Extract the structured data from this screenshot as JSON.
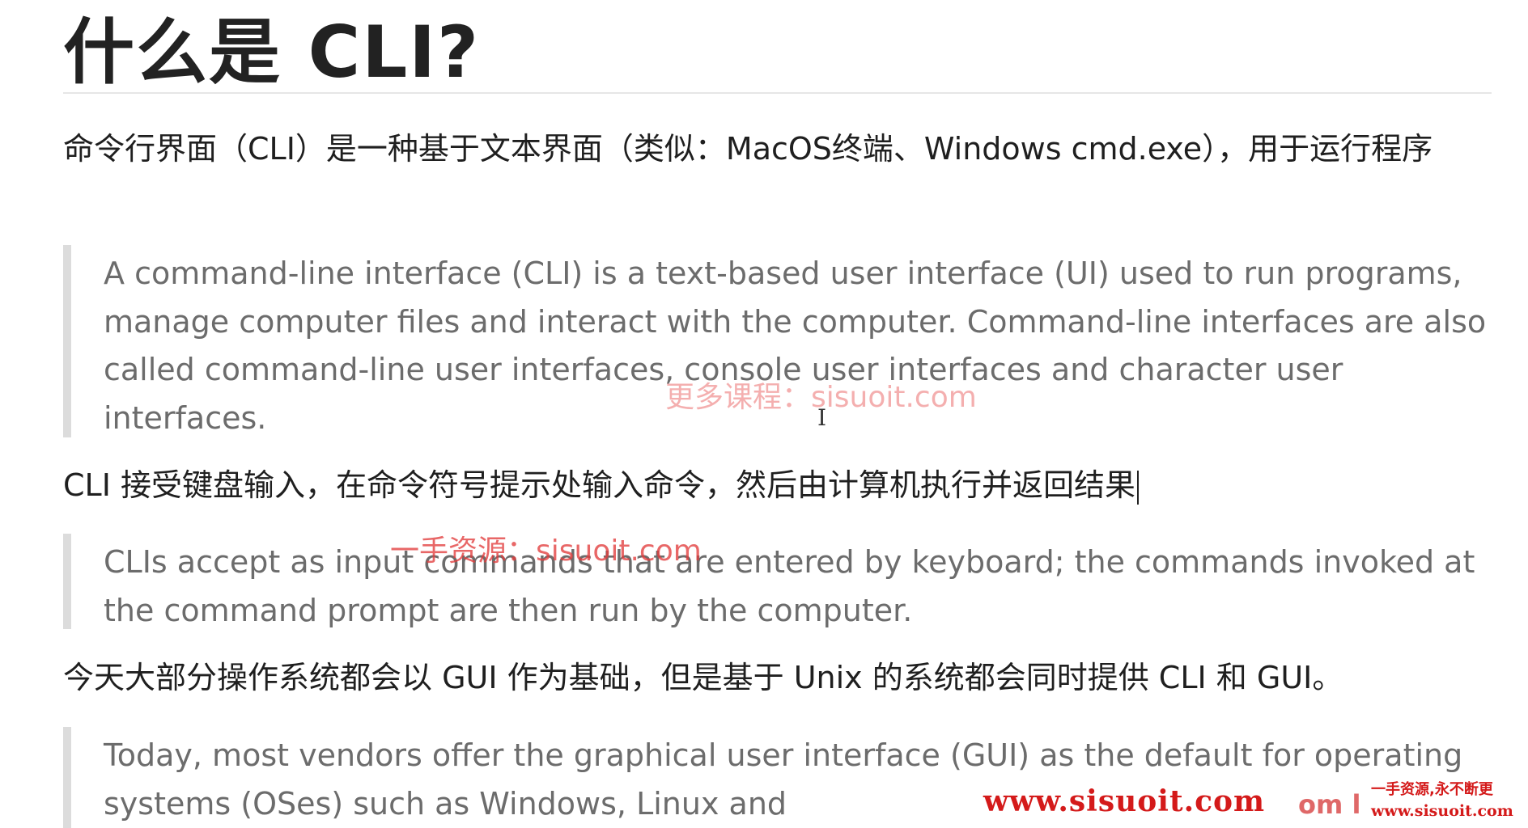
{
  "title": "什么是 CLI?",
  "paragraphs": {
    "p1": "命令行界面（CLI）是一种基于文本界面（类似：MacOS终端、Windows cmd.exe），用于运行程序",
    "p2": "CLI 接受键盘输入，在命令符号提示处输入命令，然后由计算机执行并返回结果",
    "p3": "今天大部分操作系统都会以 GUI 作为基础，但是基于 Unix 的系统都会同时提供 CLI 和 GUI。"
  },
  "quotes": {
    "q1": "A command-line interface (CLI) is a text-based user interface (UI) used to run programs, manage computer files and interact with the computer. Command-line interfaces are also called command-line user interfaces, console user interfaces and character user interfaces.",
    "q2": "CLIs accept as input commands that are entered by keyboard; the commands invoked at the command prompt are then run by the computer.",
    "q3": "Today, most vendors offer the graphical user interface (GUI) as the default for operating systems (OSes) such as Windows, Linux and"
  },
  "watermarks": {
    "w1": "更多课程：sisuoit.com",
    "w2": "一手资源：sisuoit.com",
    "w3": "www.sisuoit.com",
    "w3b": "om l",
    "w4": "一手资源,永不断更",
    "w5": "www.sisuoit.com"
  },
  "colors": {
    "text": "#1f1f1f",
    "quote_text": "#6c6c6c",
    "quote_border": "#dcdcdc",
    "watermark": "#d41a1a"
  }
}
